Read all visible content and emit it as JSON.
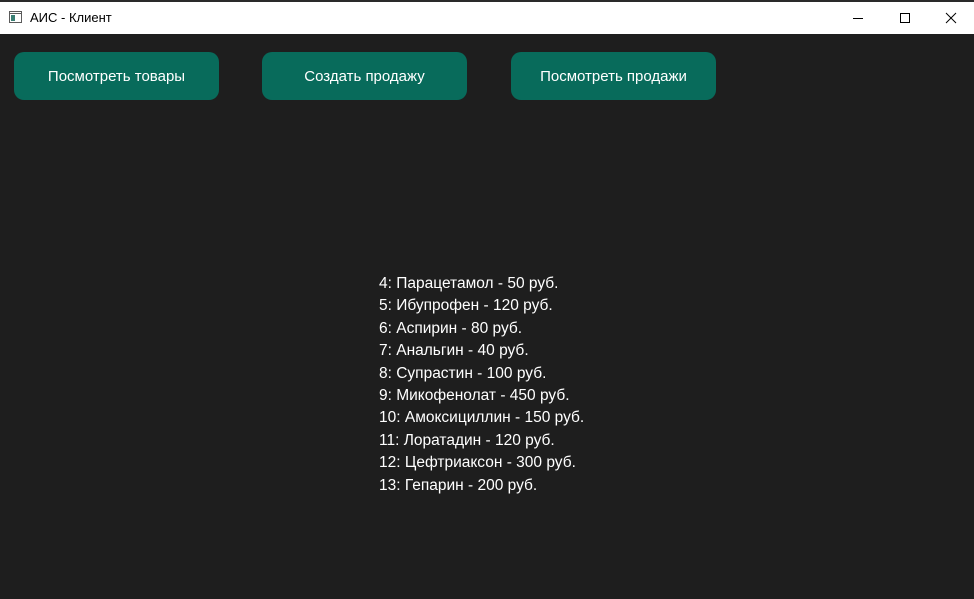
{
  "window": {
    "title": "АИС - Клиент"
  },
  "toolbar": {
    "buttons": [
      {
        "label": "Посмотреть товары"
      },
      {
        "label": "Создать продажу"
      },
      {
        "label": "Посмотреть продажи"
      }
    ]
  },
  "products": [
    "4: Парацетамол - 50 руб.",
    "5: Ибупрофен - 120 руб.",
    "6: Аспирин - 80 руб.",
    "7: Анальгин - 40 руб.",
    "8: Супрастин - 100 руб.",
    "9: Микофенолат - 450 руб.",
    "10: Амоксициллин - 150 руб.",
    "11: Лоратадин - 120 руб.",
    "12: Цефтриаксон - 300 руб.",
    "13: Гепарин - 200 руб."
  ],
  "colors": {
    "background": "#1e1e1e",
    "button": "#086b5b",
    "text": "#ffffff",
    "titlebar": "#ffffff"
  },
  "icons": {
    "app": "app-window-icon",
    "minimize": "minimize-icon",
    "maximize": "maximize-icon",
    "close": "close-icon"
  }
}
